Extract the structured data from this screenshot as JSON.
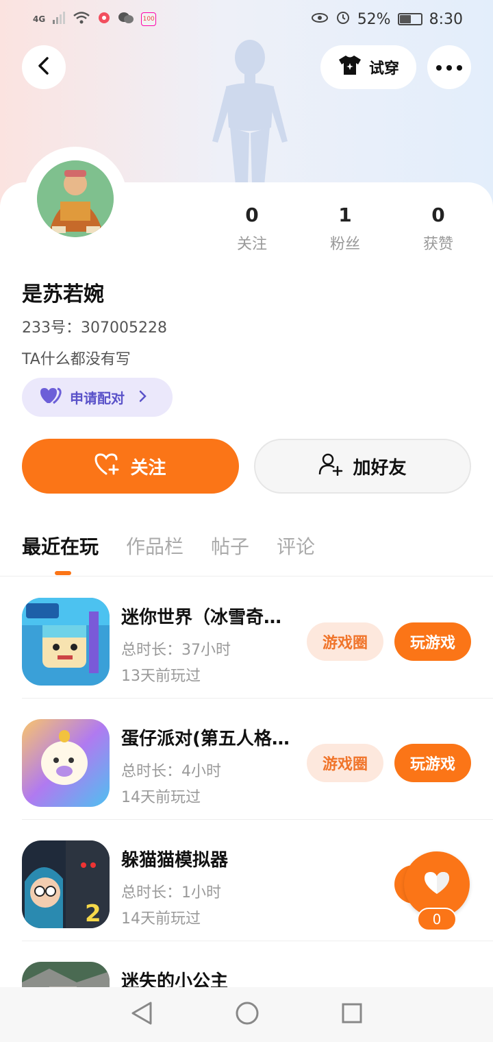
{
  "status_bar": {
    "network": "4G",
    "battery": "52%",
    "time": "8:30"
  },
  "header": {
    "try_on_label": "试穿"
  },
  "profile": {
    "name": "是苏若婉",
    "id_text": "233号：307005228",
    "bio": "TA什么都没有写",
    "pair_label": "申请配对",
    "stats": [
      {
        "value": "0",
        "label": "关注"
      },
      {
        "value": "1",
        "label": "粉丝"
      },
      {
        "value": "0",
        "label": "获赞"
      }
    ]
  },
  "actions": {
    "follow_label": "关注",
    "add_friend_label": "加好友"
  },
  "tabs": [
    "最近在玩",
    "作品栏",
    "帖子",
    "评论"
  ],
  "games": [
    {
      "name": "迷你世界（冰雪奇…",
      "time": "总时长：37小时",
      "last": "13天前玩过",
      "circle": "游戏圈",
      "play": "玩游戏"
    },
    {
      "name": "蛋仔派对(第五人格…",
      "time": "总时长：4小时",
      "last": "14天前玩过",
      "circle": "游戏圈",
      "play": "玩游戏"
    },
    {
      "name": "躲猫猫模拟器",
      "time": "总时长：1小时",
      "last": "14天前玩过",
      "circle": "",
      "play": ""
    },
    {
      "name": "迷失的小公主",
      "time": "",
      "last": "",
      "circle": "",
      "play": ""
    }
  ],
  "like": {
    "count": "0"
  },
  "colors": {
    "accent": "#fb7517",
    "pair": "#5a52c9"
  }
}
